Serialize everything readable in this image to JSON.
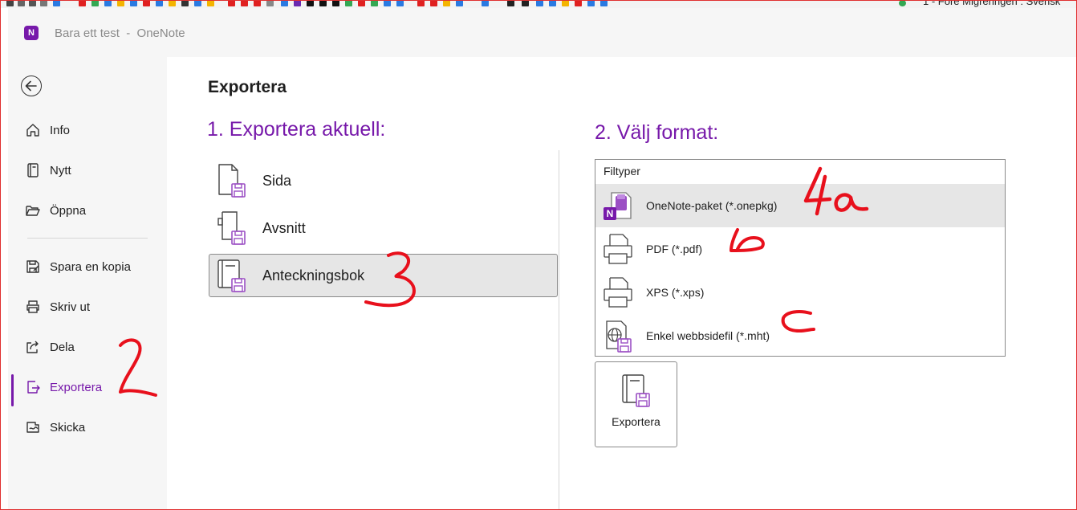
{
  "colors": {
    "accent": "#7719aa",
    "annotation_red": "#e8101c",
    "selection_bg": "#e6e6e6"
  },
  "browser_tab": {
    "partial_title": "1 - Före Migreringen : Svensk"
  },
  "window": {
    "title": "Bara ett test  -  OneNote",
    "app_icon": "onenote-icon"
  },
  "nav": {
    "back_icon": "back-arrow-icon",
    "items": [
      {
        "label": "Info",
        "icon": "home-icon"
      },
      {
        "label": "Nytt",
        "icon": "notebook-icon"
      },
      {
        "label": "Öppna",
        "icon": "folder-open-icon"
      },
      {
        "label": "Spara en kopia",
        "icon": "save-copy-icon"
      },
      {
        "label": "Skriv ut",
        "icon": "printer-icon"
      },
      {
        "label": "Dela",
        "icon": "share-icon"
      },
      {
        "label": "Exportera",
        "icon": "export-icon",
        "active": true
      },
      {
        "label": "Skicka",
        "icon": "send-icon"
      }
    ]
  },
  "main": {
    "title": "Exportera",
    "step1_title": "1. Exportera aktuell:",
    "scope_items": [
      {
        "label": "Sida",
        "icon": "page-export-icon"
      },
      {
        "label": "Avsnitt",
        "icon": "section-export-icon"
      },
      {
        "label": "Anteckningsbok",
        "icon": "notebook-export-icon",
        "selected": true
      }
    ],
    "step2_title": "2. Välj format:",
    "format_header": "Filtyper",
    "formats": [
      {
        "label": "OneNote-paket (*.onepkg)",
        "icon": "onenote-package-icon",
        "selected": true
      },
      {
        "label": "PDF (*.pdf)",
        "icon": "pdf-printer-icon"
      },
      {
        "label": "XPS (*.xps)",
        "icon": "xps-printer-icon"
      },
      {
        "label": "Enkel webbsidefil (*.mht)",
        "icon": "web-page-icon"
      }
    ],
    "export_button_label": "Exportera"
  },
  "annotations": {
    "nav_mark": "2",
    "scope_mark": "3",
    "format_mark_onepkg": "4a",
    "format_mark_pdf": "b",
    "format_mark_mht": "c"
  }
}
